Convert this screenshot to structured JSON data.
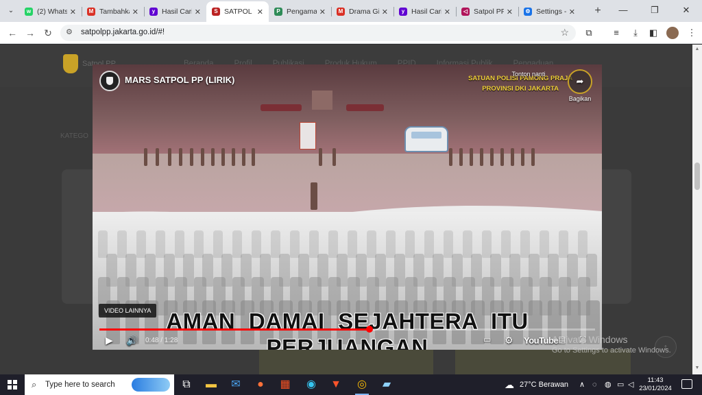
{
  "browser": {
    "tabs": [
      {
        "label": "(2) Whats",
        "color": "#25d366",
        "glyph": "w"
      },
      {
        "label": "Tambahka",
        "color": "#d93025",
        "glyph": "M"
      },
      {
        "label": "Hasil Cari",
        "color": "#6001d2",
        "glyph": "y"
      },
      {
        "label": "SATPOL P",
        "color": "#b22",
        "glyph": "S"
      },
      {
        "label": "Pengama",
        "color": "#2e8b57",
        "glyph": "P"
      },
      {
        "label": "Drama Gi",
        "color": "#d93025",
        "glyph": "M"
      },
      {
        "label": "Hasil Cari",
        "color": "#6001d2",
        "glyph": "y"
      },
      {
        "label": "Satpol PP",
        "color": "#b0145a",
        "glyph": "◁"
      },
      {
        "label": "Settings -",
        "color": "#1a73e8",
        "glyph": "⚙"
      }
    ],
    "active_tab_index": 3,
    "url": "satpolpp.jakarta.go.id/#!"
  },
  "site": {
    "name": "Satpol PP",
    "nav": [
      "Beranda",
      "Profil",
      "Publikasi",
      "Produk Hukum",
      "PPID",
      "Informasi Publik",
      "Pengaduan"
    ],
    "side_label": "KATEGO"
  },
  "video": {
    "title": "MARS SATPOL PP (LIRIK)",
    "watermark_line1": "SATUAN POLISI PAMONG PRAJA",
    "watermark_line2": "PROVINSI DKI JAKARTA",
    "watch_later": "Tonton nanti",
    "share": "Bagikan",
    "more_videos": "VIDEO LAINNYA",
    "lyric": "AMAN DAMAI SEJAHTERA  ITU PERJUANGAN",
    "time": "0:48 / 1:28",
    "progress_fraction": 0.5455,
    "youtube_label": "YouTube"
  },
  "windows_activation": {
    "line1": "Activate Windows",
    "line2": "Go to Settings to activate Windows."
  },
  "taskbar": {
    "search_placeholder": "Type here to search",
    "weather": "27°C  Berawan",
    "time": "11:43",
    "date": "23/01/2024"
  }
}
